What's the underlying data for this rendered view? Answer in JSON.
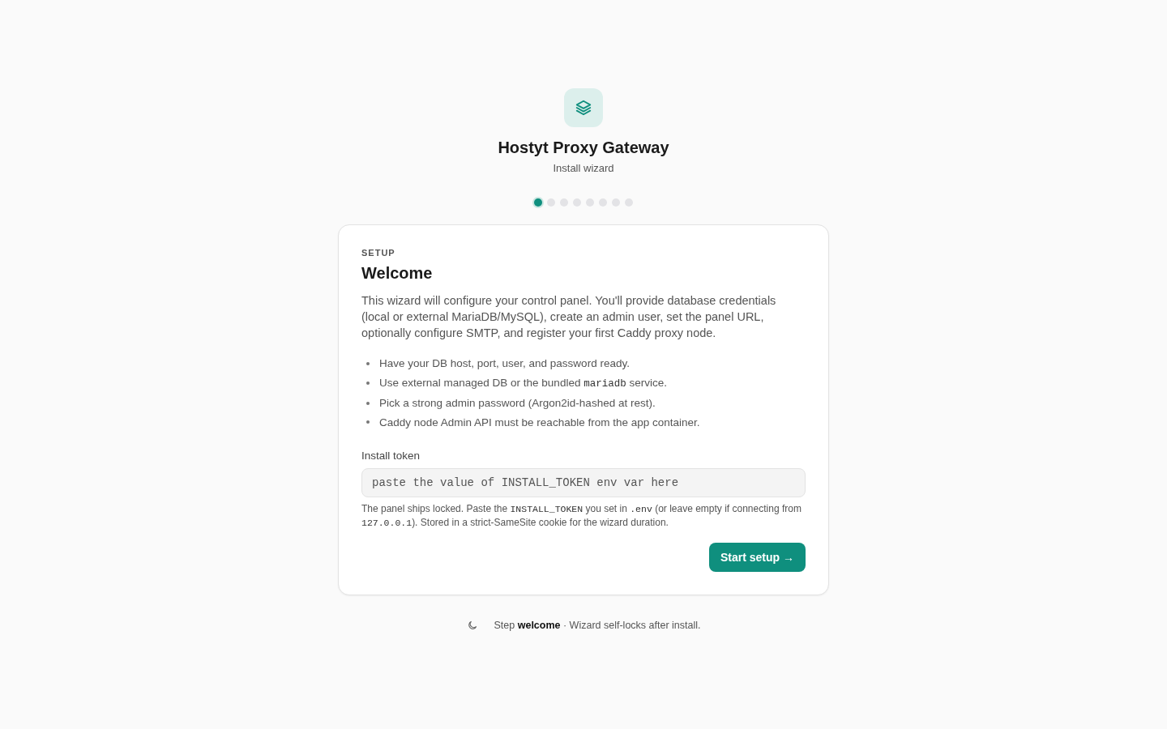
{
  "app": {
    "title": "Hostyt Proxy Gateway",
    "subtitle": "Install wizard"
  },
  "steps": [
    {
      "selected": true
    },
    {
      "selected": false
    },
    {
      "selected": false
    },
    {
      "selected": false
    },
    {
      "selected": false
    },
    {
      "selected": false
    },
    {
      "selected": false
    },
    {
      "selected": false
    }
  ],
  "card": {
    "eyebrow": "SETUP",
    "heading": "Welcome",
    "intro": "This wizard will configure your control panel. You'll provide database credentials (local or external MariaDB/MySQL), create an admin user, set the panel URL, optionally configure SMTP, and register your first Caddy proxy node.",
    "bullets": [
      [
        {
          "kind": "text",
          "text": "Have your DB host, port, user, and password ready."
        }
      ],
      [
        {
          "kind": "text",
          "text": "Use external managed DB or the bundled "
        },
        {
          "kind": "code",
          "text": "mariadb"
        },
        {
          "kind": "text",
          "text": " service."
        }
      ],
      [
        {
          "kind": "text",
          "text": "Pick a strong admin password (Argon2id-hashed at rest)."
        }
      ],
      [
        {
          "kind": "text",
          "text": "Caddy node Admin API must be reachable from the app container."
        }
      ]
    ],
    "field": {
      "label": "Install token",
      "placeholder": "paste the value of INSTALL_TOKEN env var here"
    },
    "help": [
      {
        "kind": "text",
        "text": "The panel ships locked. Paste the "
      },
      {
        "kind": "code",
        "text": "INSTALL_TOKEN"
      },
      {
        "kind": "text",
        "text": " you set in "
      },
      {
        "kind": "code",
        "text": ".env"
      },
      {
        "kind": "text",
        "text": " (or leave empty if connecting from "
      },
      {
        "kind": "code",
        "text": "127.0.0.1"
      },
      {
        "kind": "text",
        "text": "). Stored in a strict-SameSite cookie for the wizard duration."
      }
    ],
    "button": "Start setup →"
  },
  "footer": {
    "text": "Step **welcome** · Wizard self-locks after install."
  }
}
